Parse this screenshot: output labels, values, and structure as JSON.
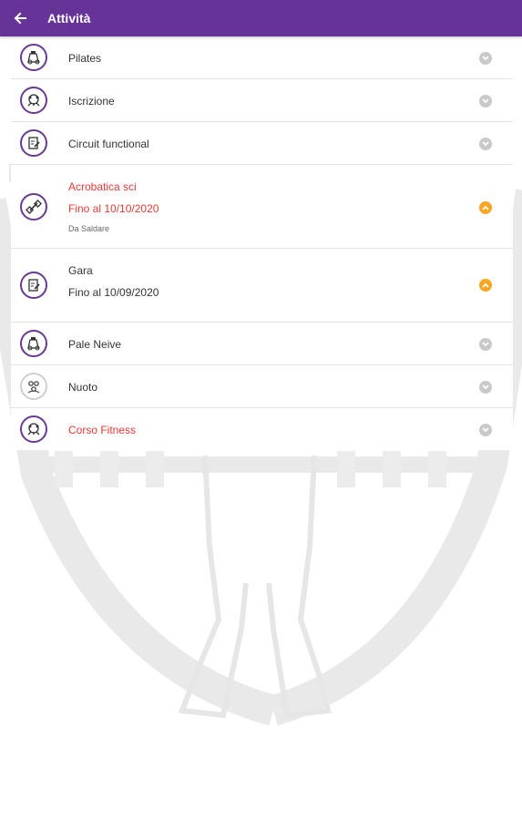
{
  "appbar": {
    "title": "Attività",
    "back_icon": "arrow-left-icon",
    "color": "#663399"
  },
  "colors": {
    "accent": "#663399",
    "alert_text": "#e53935",
    "status_orange": "#f5a623",
    "status_grey": "#c9c9c9"
  },
  "activities": [
    {
      "name": "Pilates",
      "icon": "gym-equipment-icon",
      "status": "grey"
    },
    {
      "name": "Iscrizione",
      "icon": "teamwork-icon",
      "status": "grey"
    },
    {
      "name": "Circuit functional",
      "icon": "clipboard-edit-icon",
      "status": "grey"
    },
    {
      "name": "Acrobatica sci",
      "line2": "Fino al 10/10/2020",
      "line3": "Da Saldare",
      "icon": "dumbbell-icon",
      "status": "orange",
      "highlight": true
    },
    {
      "name": "Gara",
      "line2": "Fino al 10/09/2020",
      "icon": "clipboard-edit-icon",
      "status": "orange"
    },
    {
      "name": "Pale Neive",
      "icon": "gym-equipment-icon",
      "status": "grey"
    },
    {
      "name": "Nuoto",
      "icon": "group-icon",
      "status": "grey"
    },
    {
      "name": "Corso Fitness",
      "icon": "teamwork-icon",
      "status": "grey",
      "highlight": true
    }
  ]
}
